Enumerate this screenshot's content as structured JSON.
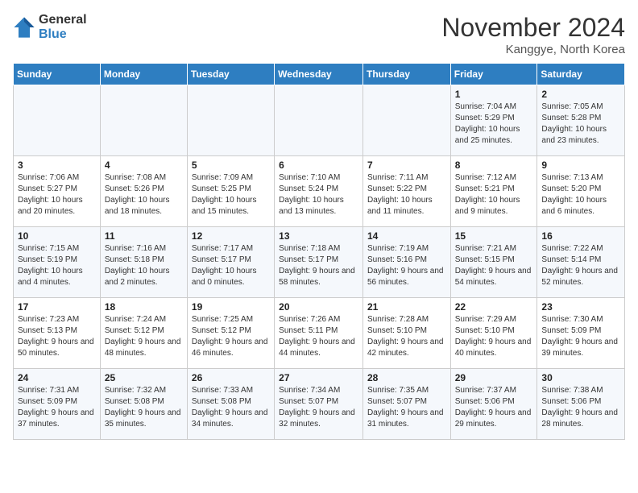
{
  "header": {
    "logo_general": "General",
    "logo_blue": "Blue",
    "month_title": "November 2024",
    "location": "Kanggye, North Korea"
  },
  "weekdays": [
    "Sunday",
    "Monday",
    "Tuesday",
    "Wednesday",
    "Thursday",
    "Friday",
    "Saturday"
  ],
  "weeks": [
    [
      {
        "day": "",
        "info": ""
      },
      {
        "day": "",
        "info": ""
      },
      {
        "day": "",
        "info": ""
      },
      {
        "day": "",
        "info": ""
      },
      {
        "day": "",
        "info": ""
      },
      {
        "day": "1",
        "info": "Sunrise: 7:04 AM\nSunset: 5:29 PM\nDaylight: 10 hours and 25 minutes."
      },
      {
        "day": "2",
        "info": "Sunrise: 7:05 AM\nSunset: 5:28 PM\nDaylight: 10 hours and 23 minutes."
      }
    ],
    [
      {
        "day": "3",
        "info": "Sunrise: 7:06 AM\nSunset: 5:27 PM\nDaylight: 10 hours and 20 minutes."
      },
      {
        "day": "4",
        "info": "Sunrise: 7:08 AM\nSunset: 5:26 PM\nDaylight: 10 hours and 18 minutes."
      },
      {
        "day": "5",
        "info": "Sunrise: 7:09 AM\nSunset: 5:25 PM\nDaylight: 10 hours and 15 minutes."
      },
      {
        "day": "6",
        "info": "Sunrise: 7:10 AM\nSunset: 5:24 PM\nDaylight: 10 hours and 13 minutes."
      },
      {
        "day": "7",
        "info": "Sunrise: 7:11 AM\nSunset: 5:22 PM\nDaylight: 10 hours and 11 minutes."
      },
      {
        "day": "8",
        "info": "Sunrise: 7:12 AM\nSunset: 5:21 PM\nDaylight: 10 hours and 9 minutes."
      },
      {
        "day": "9",
        "info": "Sunrise: 7:13 AM\nSunset: 5:20 PM\nDaylight: 10 hours and 6 minutes."
      }
    ],
    [
      {
        "day": "10",
        "info": "Sunrise: 7:15 AM\nSunset: 5:19 PM\nDaylight: 10 hours and 4 minutes."
      },
      {
        "day": "11",
        "info": "Sunrise: 7:16 AM\nSunset: 5:18 PM\nDaylight: 10 hours and 2 minutes."
      },
      {
        "day": "12",
        "info": "Sunrise: 7:17 AM\nSunset: 5:17 PM\nDaylight: 10 hours and 0 minutes."
      },
      {
        "day": "13",
        "info": "Sunrise: 7:18 AM\nSunset: 5:17 PM\nDaylight: 9 hours and 58 minutes."
      },
      {
        "day": "14",
        "info": "Sunrise: 7:19 AM\nSunset: 5:16 PM\nDaylight: 9 hours and 56 minutes."
      },
      {
        "day": "15",
        "info": "Sunrise: 7:21 AM\nSunset: 5:15 PM\nDaylight: 9 hours and 54 minutes."
      },
      {
        "day": "16",
        "info": "Sunrise: 7:22 AM\nSunset: 5:14 PM\nDaylight: 9 hours and 52 minutes."
      }
    ],
    [
      {
        "day": "17",
        "info": "Sunrise: 7:23 AM\nSunset: 5:13 PM\nDaylight: 9 hours and 50 minutes."
      },
      {
        "day": "18",
        "info": "Sunrise: 7:24 AM\nSunset: 5:12 PM\nDaylight: 9 hours and 48 minutes."
      },
      {
        "day": "19",
        "info": "Sunrise: 7:25 AM\nSunset: 5:12 PM\nDaylight: 9 hours and 46 minutes."
      },
      {
        "day": "20",
        "info": "Sunrise: 7:26 AM\nSunset: 5:11 PM\nDaylight: 9 hours and 44 minutes."
      },
      {
        "day": "21",
        "info": "Sunrise: 7:28 AM\nSunset: 5:10 PM\nDaylight: 9 hours and 42 minutes."
      },
      {
        "day": "22",
        "info": "Sunrise: 7:29 AM\nSunset: 5:10 PM\nDaylight: 9 hours and 40 minutes."
      },
      {
        "day": "23",
        "info": "Sunrise: 7:30 AM\nSunset: 5:09 PM\nDaylight: 9 hours and 39 minutes."
      }
    ],
    [
      {
        "day": "24",
        "info": "Sunrise: 7:31 AM\nSunset: 5:09 PM\nDaylight: 9 hours and 37 minutes."
      },
      {
        "day": "25",
        "info": "Sunrise: 7:32 AM\nSunset: 5:08 PM\nDaylight: 9 hours and 35 minutes."
      },
      {
        "day": "26",
        "info": "Sunrise: 7:33 AM\nSunset: 5:08 PM\nDaylight: 9 hours and 34 minutes."
      },
      {
        "day": "27",
        "info": "Sunrise: 7:34 AM\nSunset: 5:07 PM\nDaylight: 9 hours and 32 minutes."
      },
      {
        "day": "28",
        "info": "Sunrise: 7:35 AM\nSunset: 5:07 PM\nDaylight: 9 hours and 31 minutes."
      },
      {
        "day": "29",
        "info": "Sunrise: 7:37 AM\nSunset: 5:06 PM\nDaylight: 9 hours and 29 minutes."
      },
      {
        "day": "30",
        "info": "Sunrise: 7:38 AM\nSunset: 5:06 PM\nDaylight: 9 hours and 28 minutes."
      }
    ]
  ]
}
